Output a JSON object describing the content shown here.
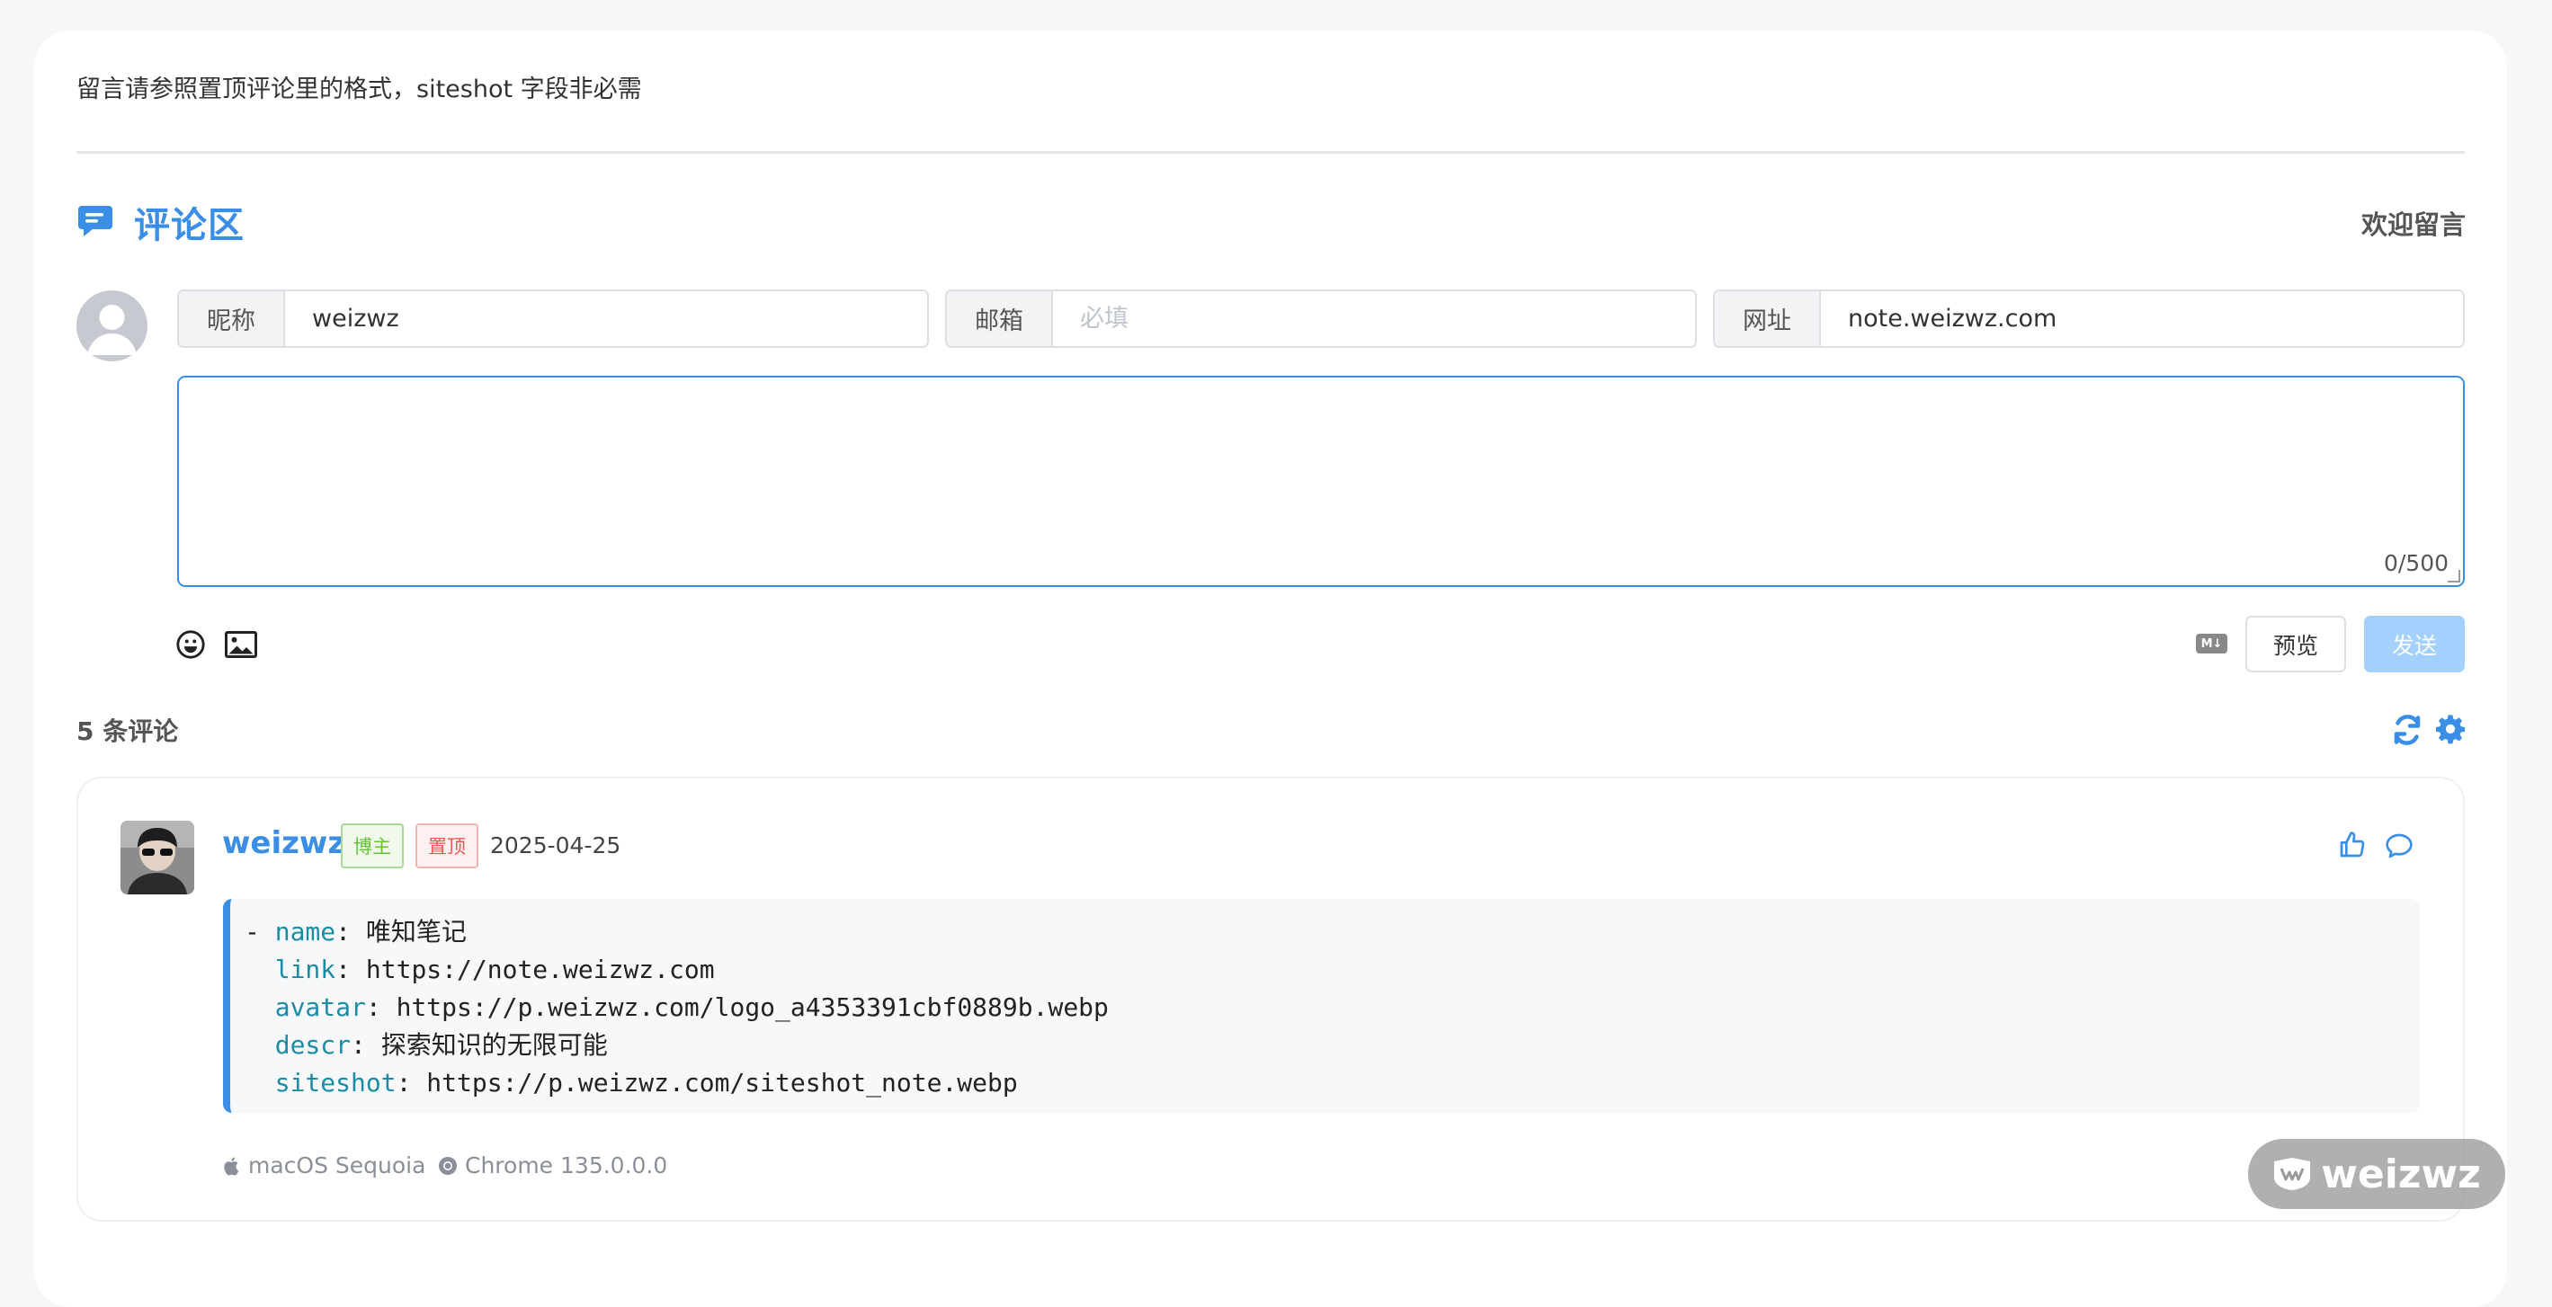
{
  "notice": "留言请参照置顶评论里的格式，siteshot 字段非必需",
  "comments_section": {
    "title": "评论区",
    "welcome": "欢迎留言"
  },
  "form": {
    "nick_label": "昵称",
    "nick_value": "weizwz",
    "mail_label": "邮箱",
    "mail_placeholder": "必填",
    "link_label": "网址",
    "link_value": "note.weizwz.com",
    "textarea_value": "",
    "word_count": "0/500",
    "md_badge": "M↓",
    "preview_label": "预览",
    "send_label": "发送"
  },
  "comment_count": "5 条评论",
  "comment": {
    "nick": "weizwz",
    "badge_master": "博主",
    "badge_top": "置顶",
    "date": "2025-04-25",
    "lines": [
      {
        "prefix": "- ",
        "key": "name",
        "value": "唯知笔记"
      },
      {
        "prefix": "  ",
        "key": "link",
        "value": "https://note.weizwz.com"
      },
      {
        "prefix": "  ",
        "key": "avatar",
        "value": "https://p.weizwz.com/logo_a4353391cbf0889b.webp"
      },
      {
        "prefix": "  ",
        "key": "descr",
        "value": "探索知识的无限可能"
      },
      {
        "prefix": "  ",
        "key": "siteshot",
        "value": "https://p.weizwz.com/siteshot_note.webp"
      }
    ],
    "os": "macOS Sequoia",
    "browser": "Chrome 135.0.0.0"
  },
  "watermark": "weizwz",
  "colors": {
    "accent": "#3a8ee6",
    "send_disabled": "#a3d0fd",
    "badge_master": "#67c23a",
    "badge_top": "#ee5555"
  }
}
